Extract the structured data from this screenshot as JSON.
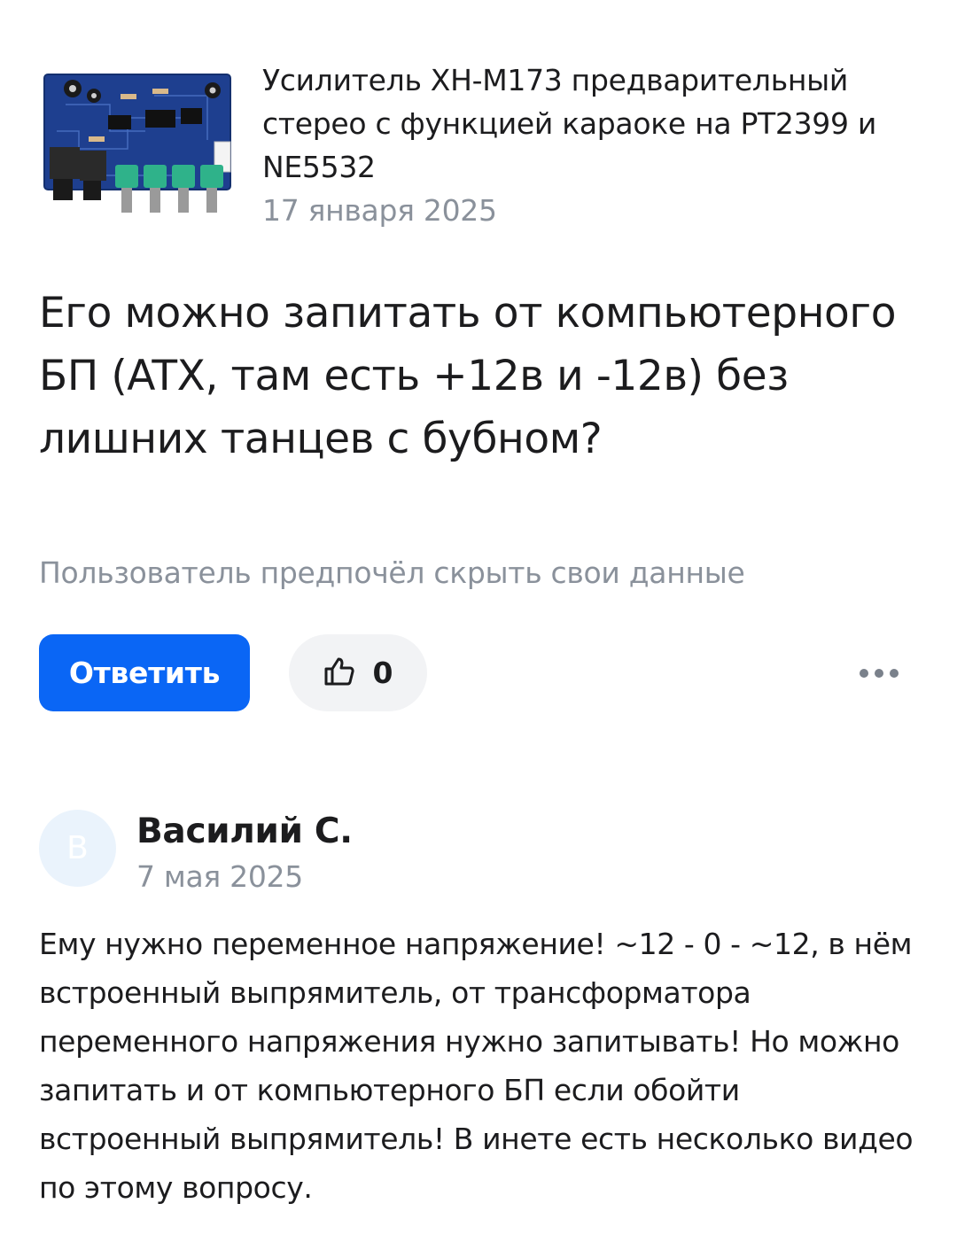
{
  "product": {
    "image_icon": "pcb-board-image",
    "title": "Усилитель XH-M173 предварительный стерео с функцией караоке на PT2399 и NE5532",
    "date": "17 января 2025"
  },
  "question": {
    "text": "Его можно запитать от компьютерного БП (ATX, там есть +12в и -12в) без лишних танцев с бубном?",
    "author": "Пользователь предпочёл скрыть свои данные"
  },
  "actions": {
    "reply_label": "Ответить",
    "like_icon": "thumbs-up-icon",
    "like_count": "0",
    "more_icon": "more-dots-icon"
  },
  "answer": {
    "avatar_letter": "В",
    "author_name": "Василий С.",
    "date": "7 мая 2025",
    "text": "Ему нужно переменное напряжение! ~12 - 0 - ~12, в нём встроенный выпрямитель, от трансформатора переменного напряжения нужно запитывать! Но можно запитать и от компьютерного БП если обойти встроенный выпрямитель! В инете есть несколько видео по этому вопросу."
  },
  "colors": {
    "accent": "#0a66f5",
    "secondary_text": "#8a919b",
    "primary_text": "#1c1c1e",
    "chip_bg": "#f2f3f5",
    "avatar_bg": "#eaf3fc",
    "pcb_blue": "#1e3f8f"
  }
}
